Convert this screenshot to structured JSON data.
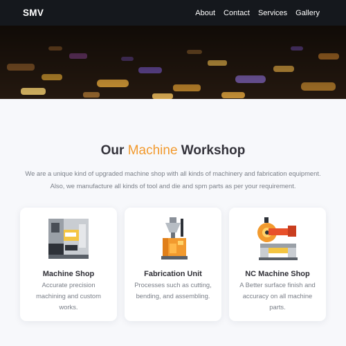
{
  "navbar": {
    "brand": "SMV",
    "links": [
      "About",
      "Contact",
      "Services",
      "Gallery"
    ]
  },
  "workshop": {
    "title_prefix": "Our ",
    "title_accent": "Machine",
    "title_suffix": " Workshop",
    "description": "We are a unique kind of upgraded machine shop with all kinds of machinery and fabrication equipment. Also, we manufacture all kinds of tool and die and spm parts as per your requirement.",
    "accent_color": "#f29a2e",
    "cards": [
      {
        "title": "Machine Shop",
        "text": "Accurate precision machining and custom works.",
        "icon": "cnc-machine-icon"
      },
      {
        "title": "Fabrication Unit",
        "text": "Processes such as cutting, bending, and assembling.",
        "icon": "fabrication-machine-icon"
      },
      {
        "title": "NC Machine Shop",
        "text": "A Better surface finish and accuracy on all machine parts.",
        "icon": "saw-machine-icon"
      }
    ]
  }
}
